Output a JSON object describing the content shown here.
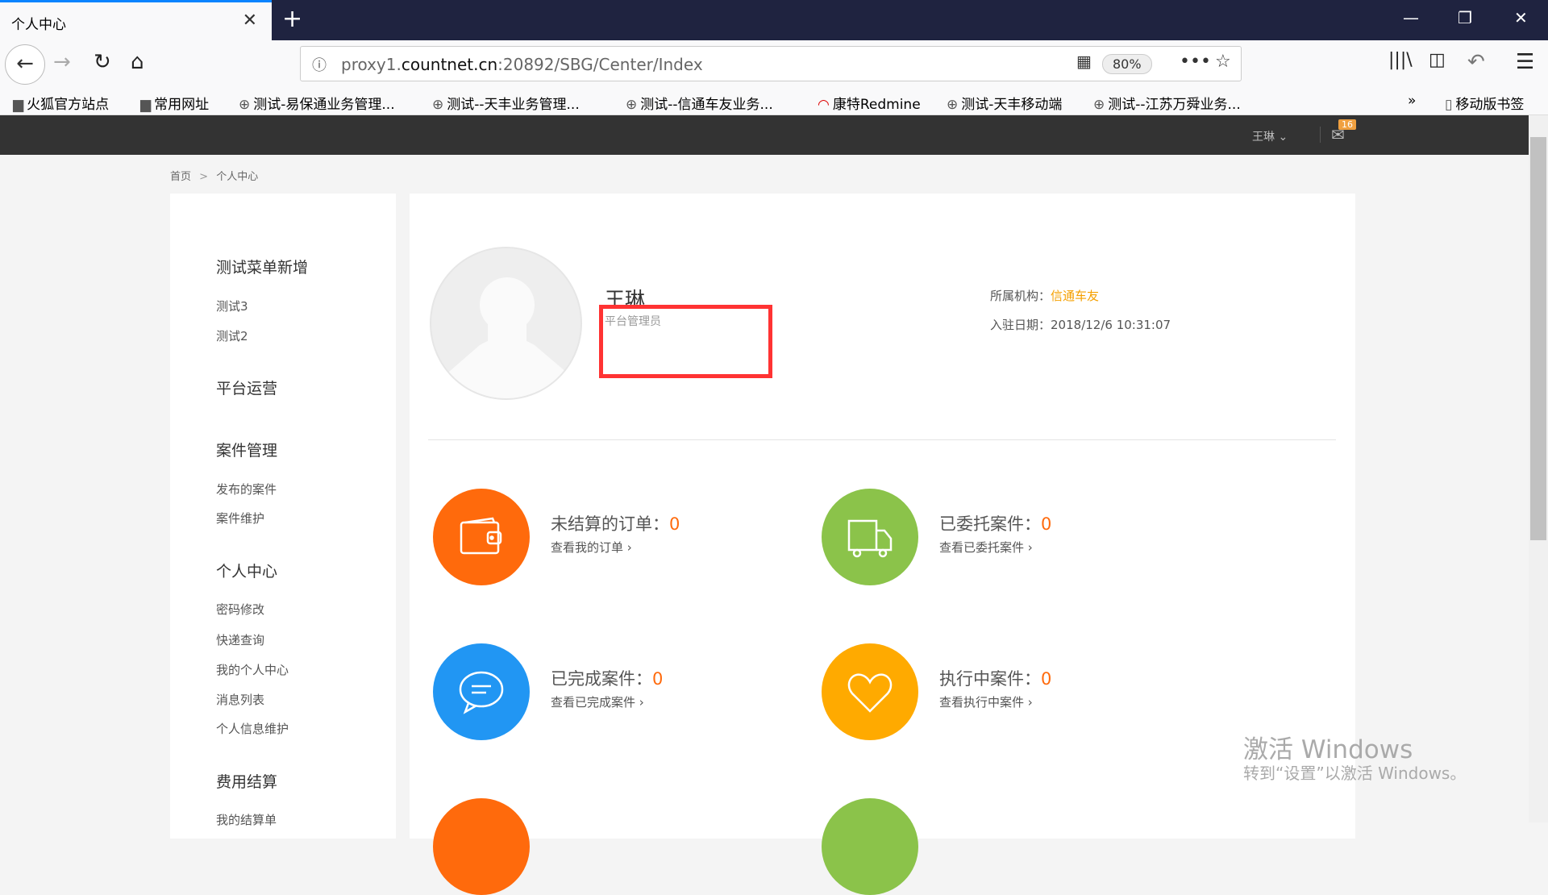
{
  "browser": {
    "tab_title": "个人中心",
    "url_prefix": "proxy1.",
    "url_domain": "countnet.cn",
    "url_rest": ":20892/SBG/Center/Index",
    "zoom": "80%",
    "bookmarks": [
      "火狐官方站点",
      "常用网址",
      "测试-易保通业务管理...",
      "测试--天丰业务管理...",
      "测试--信通车友业务...",
      "康特Redmine",
      "测试-天丰移动端",
      "测试--江苏万舜业务..."
    ],
    "mobile_bookmarks": "移动版书签"
  },
  "header": {
    "user": "王琳",
    "mail_count": "16"
  },
  "breadcrumb": {
    "home": "首页",
    "sep": ">",
    "current": "个人中心"
  },
  "sidebar": [
    {
      "h": "测试菜单新增",
      "items": [
        "测试3",
        "测试2"
      ]
    },
    {
      "h": "平台运营",
      "items": []
    },
    {
      "h": "案件管理",
      "items": [
        "发布的案件",
        "案件维护"
      ]
    },
    {
      "h": "个人中心",
      "items": [
        "密码修改",
        "快递查询",
        "我的个人中心",
        "消息列表",
        "个人信息维护"
      ]
    },
    {
      "h": "费用结算",
      "items": [
        "我的结算单"
      ]
    }
  ],
  "profile": {
    "name": "王琳",
    "role": "平台管理员",
    "org_label": "所属机构：",
    "org": "信通车友",
    "date_label": "入驻日期：",
    "date": "2018/12/6 10:31:07"
  },
  "cards": [
    {
      "title": "未结算的订单：",
      "count": "0",
      "link": "查看我的订单 ›",
      "color": "#ff6a0c",
      "icon": "wallet"
    },
    {
      "title": "已委托案件：",
      "count": "0",
      "link": "查看已委托案件 ›",
      "color": "#8bc34a",
      "icon": "truck"
    },
    {
      "title": "已完成案件：",
      "count": "0",
      "link": "查看已完成案件 ›",
      "color": "#2196f3",
      "icon": "chat"
    },
    {
      "title": "执行中案件：",
      "count": "0",
      "link": "查看执行中案件 ›",
      "color": "#ffaa00",
      "icon": "heart"
    }
  ],
  "watermark": {
    "line1": "激活 Windows",
    "line2": "转到“设置”以激活 Windows。"
  }
}
